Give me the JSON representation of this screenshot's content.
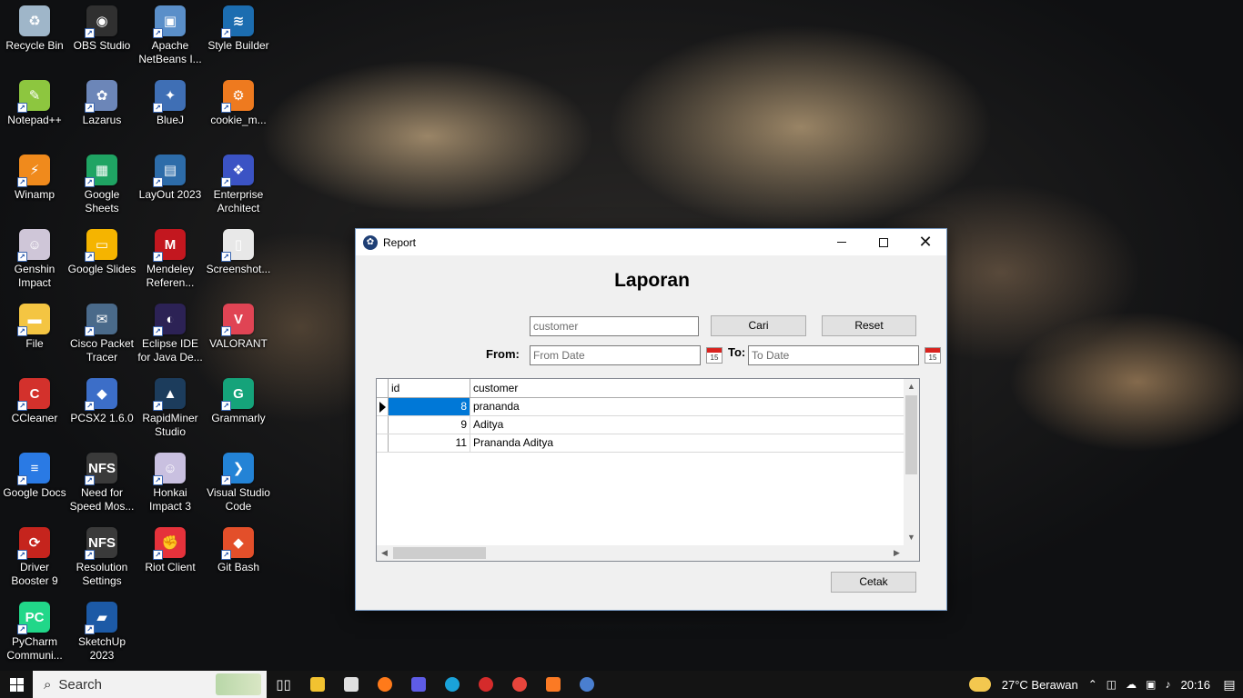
{
  "desktop": {
    "icons": [
      {
        "label": "Recycle Bin",
        "color": "#9fb6c9",
        "glyph": "♻"
      },
      {
        "label": "OBS Studio",
        "color": "#303030",
        "glyph": "◉"
      },
      {
        "label": "Apache NetBeans I...",
        "color": "#5a8fc9",
        "glyph": "▣"
      },
      {
        "label": "Style Builder",
        "color": "#1c6db0",
        "glyph": "≋"
      },
      {
        "label": "Notepad++",
        "color": "#8dc63f",
        "glyph": "✎"
      },
      {
        "label": "Lazarus",
        "color": "#6c86b8",
        "glyph": "✿"
      },
      {
        "label": "BlueJ",
        "color": "#3f6fb5",
        "glyph": "✦"
      },
      {
        "label": "cookie_m...",
        "color": "#ee7a1f",
        "glyph": "⚙"
      },
      {
        "label": "Winamp",
        "color": "#f08a1c",
        "glyph": "⚡"
      },
      {
        "label": "Google Sheets",
        "color": "#1fa463",
        "glyph": "▦"
      },
      {
        "label": "LayOut 2023",
        "color": "#2d6ca9",
        "glyph": "▤"
      },
      {
        "label": "Enterprise Architect",
        "color": "#3b53c4",
        "glyph": "❖"
      },
      {
        "label": "Genshin Impact",
        "color": "#cfc6d8",
        "glyph": "☺"
      },
      {
        "label": "Google Slides",
        "color": "#f5b400",
        "glyph": "▭"
      },
      {
        "label": "Mendeley Referen...",
        "color": "#c3171f",
        "glyph": "M"
      },
      {
        "label": "Screenshot...",
        "color": "#e8e8e8",
        "glyph": "▯"
      },
      {
        "label": "File",
        "color": "#f4c542",
        "glyph": "▬"
      },
      {
        "label": "Cisco Packet Tracer",
        "color": "#4a6a8a",
        "glyph": "✉"
      },
      {
        "label": "Eclipse IDE for Java De...",
        "color": "#2c2255",
        "glyph": "◐"
      },
      {
        "label": "VALORANT",
        "color": "#e04454",
        "glyph": "V"
      },
      {
        "label": "CCleaner",
        "color": "#d3312c",
        "glyph": "C"
      },
      {
        "label": "PCSX2 1.6.0",
        "color": "#3c6ec8",
        "glyph": "◆"
      },
      {
        "label": "RapidMiner Studio",
        "color": "#1c3c5c",
        "glyph": "▲"
      },
      {
        "label": "Grammarly",
        "color": "#15a37a",
        "glyph": "G"
      },
      {
        "label": "Google Docs",
        "color": "#2a7ae4",
        "glyph": "≡"
      },
      {
        "label": "Need for Speed Mos...",
        "color": "#3a3a3a",
        "glyph": "NFS"
      },
      {
        "label": "Honkai Impact 3",
        "color": "#c9c0e0",
        "glyph": "☺"
      },
      {
        "label": "Visual Studio Code",
        "color": "#2383d6",
        "glyph": "❯"
      },
      {
        "label": "Driver Booster 9",
        "color": "#c5241d",
        "glyph": "⟳"
      },
      {
        "label": "Resolution Settings",
        "color": "#3a3a3a",
        "glyph": "NFS"
      },
      {
        "label": "Riot Client",
        "color": "#e5323b",
        "glyph": "✊"
      },
      {
        "label": "Git Bash",
        "color": "#e34f2a",
        "glyph": "◆"
      },
      {
        "label": "PyCharm Communi...",
        "color": "#21d789",
        "glyph": "PC"
      },
      {
        "label": "SketchUp 2023",
        "color": "#1c5aa6",
        "glyph": "▰"
      }
    ]
  },
  "window": {
    "title": "Report",
    "minimize_label": "",
    "heading": "Laporan",
    "search": {
      "value": "customer"
    },
    "cari_label": "Cari",
    "reset_label": "Reset",
    "from_label": "From:",
    "from_placeholder": "From Date",
    "to_label": "To:",
    "to_placeholder": "To Date",
    "calendar_day": "15",
    "grid": {
      "columns": [
        "id",
        "customer"
      ],
      "rows": [
        {
          "id": "8",
          "customer": "prananda"
        },
        {
          "id": "9",
          "customer": "Aditya"
        },
        {
          "id": "11",
          "customer": "Prananda Aditya"
        }
      ]
    },
    "cetak_label": "Cetak"
  },
  "taskbar": {
    "search_text": "Search",
    "weather": "27°C  Berawan",
    "time": "20:16",
    "apps": [
      "task-view",
      "file-explorer",
      "store",
      "firefox",
      "unknown-app",
      "edge",
      "app-red",
      "chrome",
      "xampp",
      "settings"
    ]
  }
}
